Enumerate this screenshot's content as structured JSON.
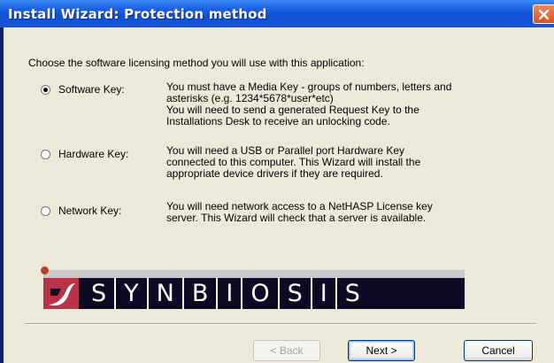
{
  "window": {
    "title": "Install Wizard: Protection method",
    "close_icon": "close-icon"
  },
  "intro": "Choose the software licensing method you will use with this application:",
  "options": [
    {
      "label": "Software Key:",
      "selected": true,
      "description": [
        "You must have a Media Key - groups of numbers, letters and",
        "asterisks (e.g. 1234*5678*user*etc)",
        "You will need to send a generated Request Key to the",
        "Installations Desk to receive an unlocking code."
      ]
    },
    {
      "label": "Hardware Key:",
      "selected": false,
      "description": [
        "You will need a USB or Parallel port Hardware Key",
        "connected to this computer. This Wizard will install the",
        "appropriate device drivers if they are required."
      ]
    },
    {
      "label": "Network Key:",
      "selected": false,
      "description": [
        "You will need network access to a NetHASP License key",
        "server. This Wizard will check that a server is available."
      ]
    }
  ],
  "logo": {
    "letters": [
      "S",
      "Y",
      "N",
      "B",
      "I",
      "O",
      "S",
      "I",
      "S"
    ],
    "accent_color": "#b8324a",
    "bar_color": "#0d0a26"
  },
  "buttons": {
    "back": "< Back",
    "next": "Next >",
    "cancel": "Cancel"
  }
}
